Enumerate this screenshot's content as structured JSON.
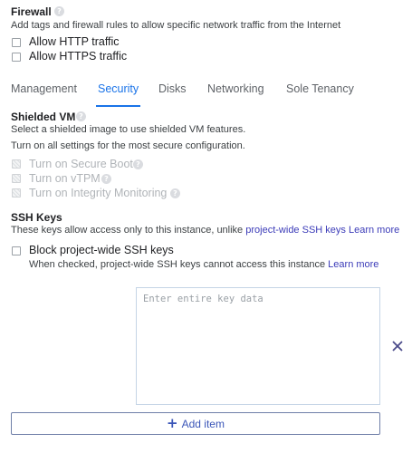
{
  "firewall": {
    "title": "Firewall",
    "description": "Add tags and firewall rules to allow specific network traffic from the Internet",
    "options": [
      {
        "label": "Allow HTTP traffic",
        "checked": false
      },
      {
        "label": "Allow HTTPS traffic",
        "checked": false
      }
    ]
  },
  "tabs": [
    {
      "label": "Management",
      "active": false
    },
    {
      "label": "Security",
      "active": true
    },
    {
      "label": "Disks",
      "active": false
    },
    {
      "label": "Networking",
      "active": false
    },
    {
      "label": "Sole Tenancy",
      "active": false
    }
  ],
  "shielded_vm": {
    "title": "Shielded VM",
    "description": "Select a shielded image to use shielded VM features.",
    "note": "Turn on all settings for the most secure configuration.",
    "options": [
      {
        "label": "Turn on Secure Boot",
        "disabled": true,
        "has_help": true
      },
      {
        "label": "Turn on vTPM",
        "disabled": true,
        "has_help": true
      },
      {
        "label": "Turn on Integrity Monitoring",
        "disabled": true,
        "has_help": true
      }
    ]
  },
  "ssh_keys": {
    "title": "SSH Keys",
    "description": "These keys allow access only to this instance, unlike",
    "project_link": "project-wide SSH keys",
    "learn_more": "Learn more",
    "block_label": "Block project-wide SSH keys",
    "block_help": "When checked, project-wide SSH keys cannot access this instance",
    "block_learn_more": "Learn more",
    "key_placeholder": "Enter entire key data",
    "key_value": ""
  },
  "add_item": {
    "label": "Add item"
  },
  "colors": {
    "accent": "#1a73e8",
    "link": "#3b3bb8",
    "close": "#4a4a8a"
  }
}
